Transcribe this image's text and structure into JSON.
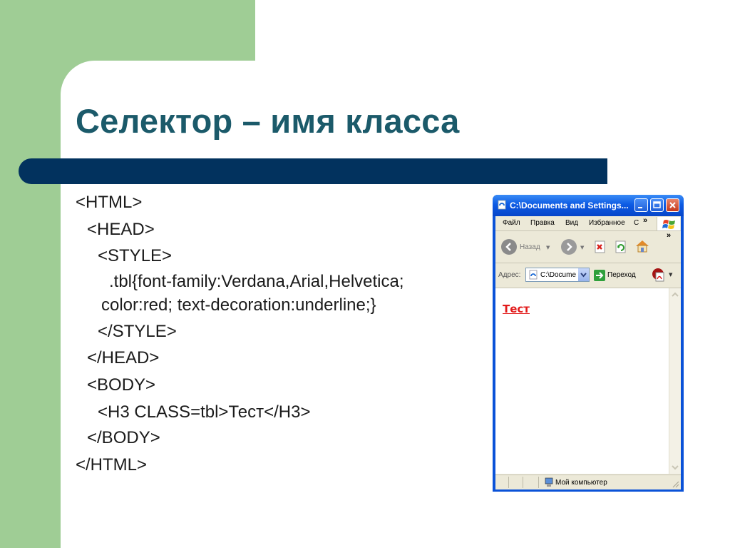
{
  "slide": {
    "title": "Селектор – имя класса",
    "colors": {
      "green": "#9fcd95",
      "title": "#1b5a6a",
      "bar": "#02325e"
    }
  },
  "code_lines": [
    "<HTML>",
    "<HEAD>",
    "<STYLE>",
    ".tbl{font-family:Verdana,Arial,Helvetica;",
    "color:red; text-decoration:underline;}",
    "</STYLE>",
    "</HEAD>",
    "<BODY>",
    "<H3 CLASS=tbl>Тест</H3>",
    "</BODY>",
    "</HTML>"
  ],
  "browser": {
    "title": "C:\\Documents and Settings...",
    "menu": [
      "Файл",
      "Правка",
      "Вид",
      "Избранное",
      "С"
    ],
    "menu_more": "»",
    "toolbar": {
      "back_label": "Назад",
      "more": "»"
    },
    "address": {
      "label": "Адрес:",
      "value": "C:\\Documer",
      "go_label": "Переход"
    },
    "page_heading": "Тест",
    "status_text": "Мой компьютер",
    "icons": [
      "ie-page-icon",
      "minimize-icon",
      "maximize-icon",
      "close-icon",
      "windows-flag-icon",
      "back-icon",
      "forward-icon",
      "stop-icon",
      "refresh-icon",
      "home-icon",
      "go-icon",
      "acrobat-icon",
      "my-computer-icon"
    ]
  }
}
